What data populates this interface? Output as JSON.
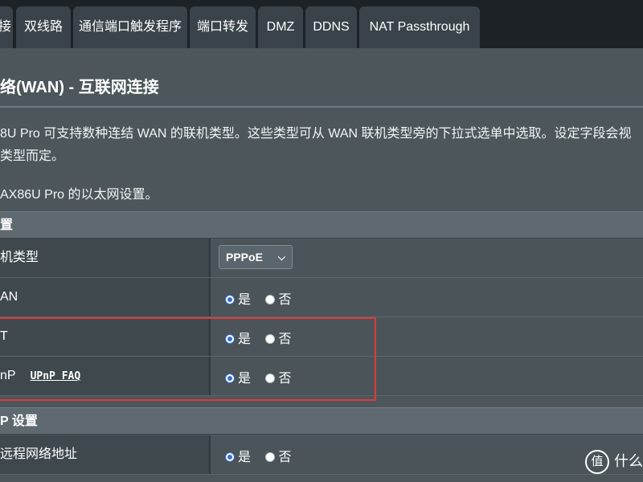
{
  "tabs": [
    {
      "label": "接"
    },
    {
      "label": "双线路"
    },
    {
      "label": "通信端口触发程序"
    },
    {
      "label": "端口转发"
    },
    {
      "label": "DMZ"
    },
    {
      "label": "DDNS"
    },
    {
      "label": "NAT Passthrough"
    }
  ],
  "page": {
    "title": "络(WAN) - 互联网连接",
    "desc_line1": "8U Pro 可支持数种连结 WAN 的联机类型。这些类型可从 WAN 联机类型旁的下拉式选单中选取。设定字段会视",
    "desc_line2": "类型而定。",
    "desc_line3": "AX86U Pro 的以太网设置。"
  },
  "section_basic": {
    "header": "置"
  },
  "rows": {
    "conn_type": {
      "label": "机类型",
      "value": "PPPoE"
    },
    "wan": {
      "label": "AN",
      "yes": "是",
      "no": "否"
    },
    "nat": {
      "label": "T",
      "yes": "是",
      "no": "否"
    },
    "upnp": {
      "label": "nP",
      "link": "UPnP  FAQ",
      "yes": "是",
      "no": "否"
    }
  },
  "section_dhcp": {
    "header": "P 设置"
  },
  "rows2": {
    "remote": {
      "label": "远程网络地址",
      "yes": "是",
      "no": "否"
    }
  },
  "watermark": {
    "text": "什么"
  },
  "colors": {
    "highlight": "#e03a3a",
    "radio_accent": "#3b6fd1"
  }
}
